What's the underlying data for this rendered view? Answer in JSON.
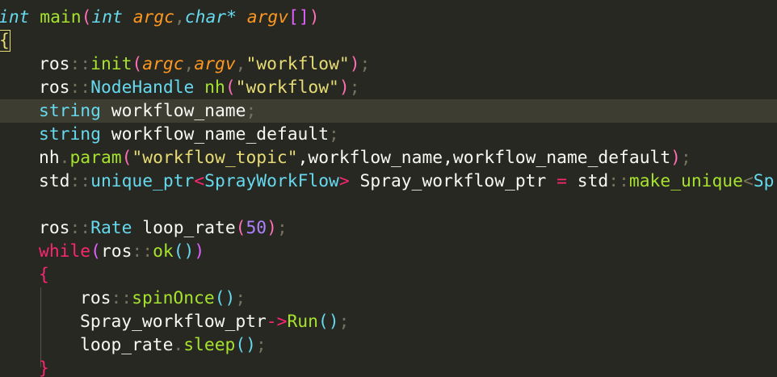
{
  "editor": {
    "theme": "monokai",
    "colors": {
      "background": "#272822",
      "current_line": "#3e3d32",
      "keyword": "#f92672",
      "type": "#66d9ef",
      "function": "#a6e22e",
      "parameter": "#fd971f",
      "string": "#e6db74",
      "number": "#ae81ff"
    },
    "lines": [
      {
        "tokens": [
          "int",
          " main",
          "(",
          "int",
          " argc",
          ",",
          "char*",
          " argv",
          "[]",
          ")"
        ]
      },
      {
        "tokens": [
          "{"
        ]
      },
      {
        "tokens": [
          "ros",
          "::",
          "init",
          "(",
          "argc",
          ",",
          "argv",
          ",",
          "\"workflow\"",
          ")",
          ";"
        ]
      },
      {
        "tokens": [
          "ros",
          "::",
          "NodeHandle",
          " nh",
          "(",
          "\"workflow\"",
          ")",
          ";"
        ]
      },
      {
        "tokens": [
          "string",
          " workflow_name",
          ";"
        ]
      },
      {
        "tokens": [
          "string",
          " workflow_name_default",
          ";"
        ]
      },
      {
        "tokens": [
          "nh",
          ".",
          "param",
          "(",
          "\"workflow_topic\"",
          ",workflow_name,workflow_name_default",
          ")",
          ";"
        ]
      },
      {
        "tokens": [
          "std",
          "::",
          "unique_ptr",
          "<",
          "SprayWorkFlow",
          ">",
          " Spray_workflow_ptr ",
          "=",
          " std",
          "::",
          "make_unique",
          "<",
          "Spra"
        ]
      },
      {
        "tokens": []
      },
      {
        "tokens": [
          "ros",
          "::",
          "Rate",
          " loop_rate",
          "(",
          "50",
          ")",
          ";"
        ]
      },
      {
        "tokens": [
          "while",
          "(",
          "ros",
          "::",
          "ok",
          "()",
          ")"
        ]
      },
      {
        "tokens": [
          "{"
        ]
      },
      {
        "tokens": [
          "ros",
          "::",
          "spinOnce",
          "()",
          ";"
        ]
      },
      {
        "tokens": [
          "Spray_workflow_ptr",
          "->",
          "Run",
          "()",
          ";"
        ]
      },
      {
        "tokens": [
          "loop_rate",
          ".",
          "sleep",
          "()",
          ";"
        ]
      },
      {
        "tokens": [
          "}"
        ]
      }
    ]
  }
}
